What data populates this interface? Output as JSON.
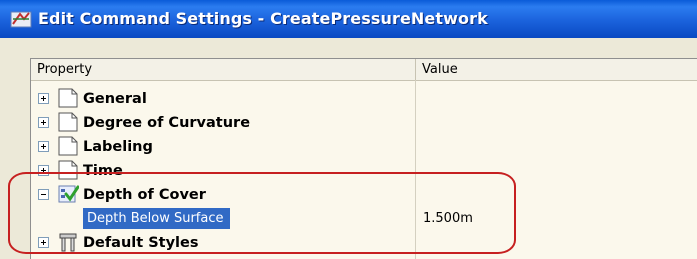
{
  "window": {
    "title": "Edit Command Settings - CreatePressureNetwork",
    "icon": "autocad-app-icon"
  },
  "table": {
    "columns": [
      "Property",
      "Value"
    ],
    "rows": [
      {
        "label": "General",
        "icon": "page-icon",
        "expanded": false,
        "value": ""
      },
      {
        "label": "Degree of Curvature",
        "icon": "page-icon",
        "expanded": false,
        "value": ""
      },
      {
        "label": "Labeling",
        "icon": "page-icon",
        "expanded": false,
        "value": ""
      },
      {
        "label": "Time",
        "icon": "page-icon",
        "expanded": false,
        "value": ""
      },
      {
        "label": "Depth of Cover",
        "icon": "checked-settings-icon",
        "expanded": true,
        "value": ""
      },
      {
        "label": "Depth Below Surface",
        "child": true,
        "selected": true,
        "value": "1.500m"
      },
      {
        "label": "Default Styles",
        "icon": "pipe-style-icon",
        "expanded": false,
        "value": ""
      }
    ]
  },
  "colors": {
    "title_bar": "#0a5bd8",
    "selection": "#316ac5",
    "annotation_ring": "#c62020",
    "panel_background": "#fbf8ec"
  }
}
